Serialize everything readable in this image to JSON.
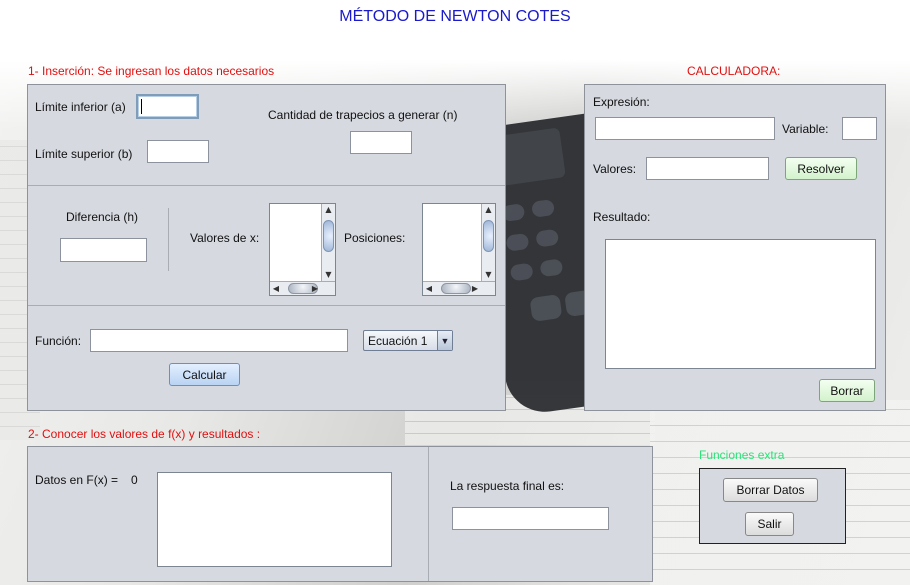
{
  "title": "MÉTODO DE NEWTON COTES",
  "section1": {
    "header": "1- Inserción: Se ingresan los datos necesarios",
    "limite_inferior_label": "Límite inferior (a)",
    "limite_inferior_value": "",
    "limite_superior_label": "Límite superior (b)",
    "limite_superior_value": "",
    "trapecios_label": "Cantidad de trapecios a generar (n)",
    "trapecios_value": "",
    "diferencia_label": "Diferencia  (h)",
    "diferencia_value": "",
    "valores_x_label": "Valores de x:",
    "posiciones_label": "Posiciones:",
    "funcion_label": "Función:",
    "funcion_value": "",
    "ecuacion_selected": "Ecuación 1",
    "calcular_label": "Calcular"
  },
  "calculadora": {
    "header": "CALCULADORA:",
    "expresion_label": "Expresión:",
    "expresion_value": "",
    "variable_label": "Variable:",
    "variable_value": "",
    "valores_label": "Valores:",
    "valores_value": "",
    "resolver_label": "Resolver",
    "resultado_label": "Resultado:",
    "borrar_label": "Borrar"
  },
  "section2": {
    "header": "2- Conocer los valores de f(x) y resultados :",
    "datos_label": "Datos en F(x) =",
    "datos_count": "0",
    "respuesta_label": "La respuesta final es:",
    "respuesta_value": ""
  },
  "extras": {
    "header": "Funciones extra",
    "borrar_datos_label": "Borrar Datos",
    "salir_label": "Salir"
  },
  "colors": {
    "title": "#1a1acc",
    "section_header": "#e01010",
    "extras_header": "#2ee07a",
    "panel_bg": "#d6d9e0"
  }
}
